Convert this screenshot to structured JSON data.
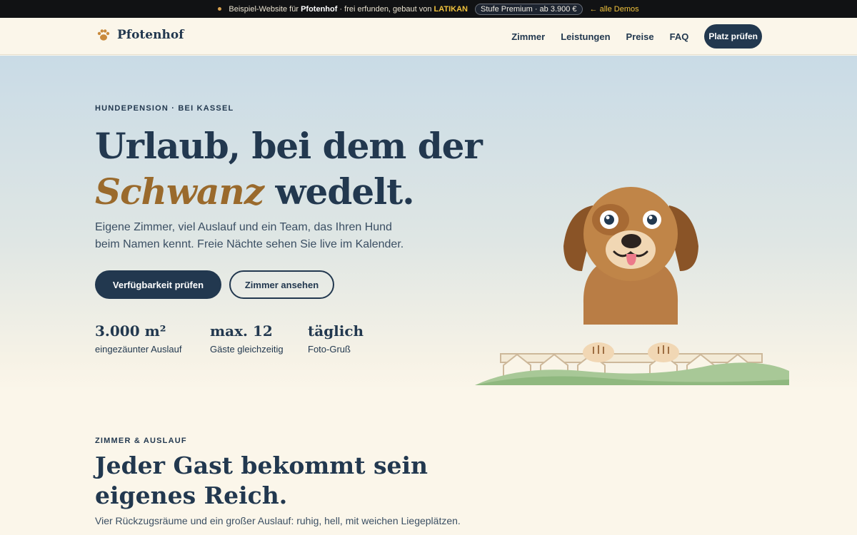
{
  "banner": {
    "prefix": "Beispiel-Website für",
    "brand": "Pfotenhof",
    "middle": "· frei erfunden, gebaut von",
    "maker": "LATIKAN",
    "tier": "Stufe Premium · ab 3.900 €",
    "back": "← alle Demos"
  },
  "nav": {
    "logo": "Pfotenhof",
    "links": [
      "Zimmer",
      "Leistungen",
      "Preise",
      "FAQ"
    ],
    "cta": "Platz prüfen"
  },
  "hero": {
    "eyebrow": "HUNDEPENSION · BEI KASSEL",
    "title_line1": "Urlaub, bei dem der",
    "title_accent": "Schwanz",
    "title_rest": " wedelt.",
    "subtitle": "Eigene Zimmer, viel Auslauf und ein Team, das Ihren Hund beim Namen kennt. Freie Nächte sehen Sie live im Kalender.",
    "primary_button": "Verfügbarkeit prüfen",
    "secondary_button": "Zimmer ansehen",
    "stats": [
      {
        "value": "3.000 m²",
        "label": "eingezäunter Auslauf"
      },
      {
        "value": "max. 12",
        "label": "Gäste gleichzeitig"
      },
      {
        "value": "täglich",
        "label": "Foto-Gruß"
      }
    ]
  },
  "section": {
    "eyebrow": "ZIMMER & AUSLAUF",
    "title": "Jeder Gast bekommt sein eigenes Reich.",
    "subtitle": "Vier Rückzugsräume und ein großer Auslauf: ruhig, hell, mit weichen Liegeplätzen."
  },
  "colors": {
    "navy": "#22384f",
    "accent": "#9a6a2c",
    "cream": "#fbf6ea",
    "banner": "#111214"
  }
}
